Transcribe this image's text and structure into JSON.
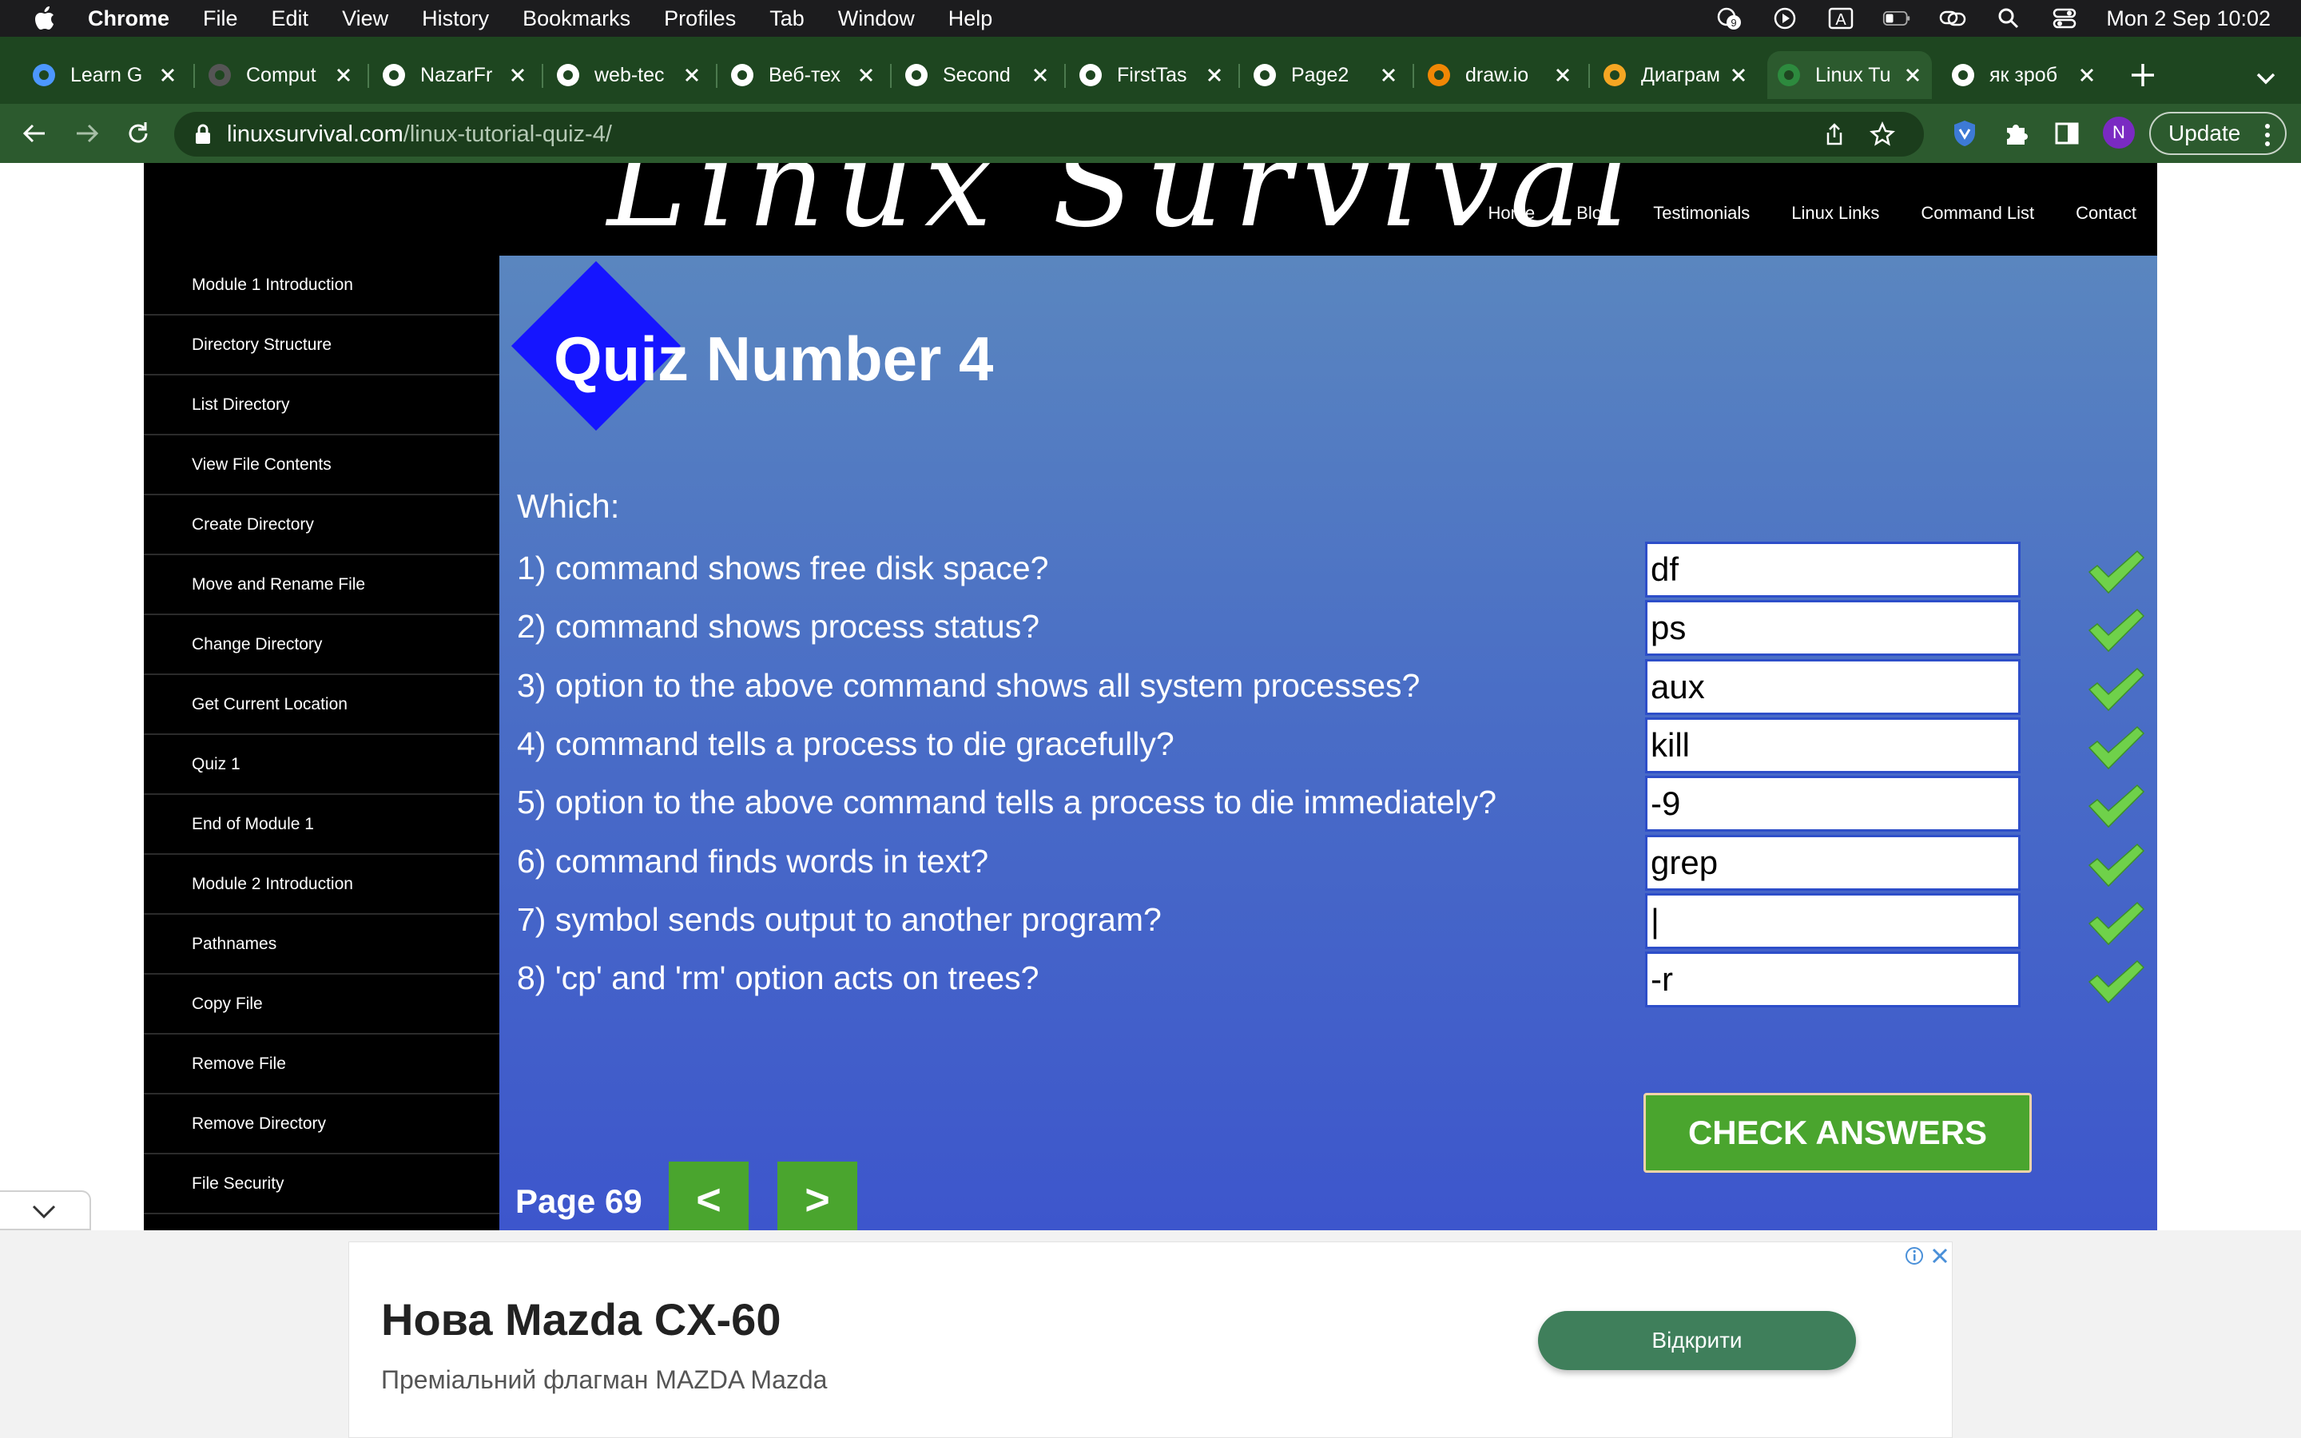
{
  "menubar": {
    "app_name": "Chrome",
    "items": [
      "File",
      "Edit",
      "View",
      "History",
      "Bookmarks",
      "Profiles",
      "Tab",
      "Window",
      "Help"
    ],
    "clock": "Mon 2 Sep  10:02",
    "input_source": "A",
    "notification_count": "9"
  },
  "tabs": [
    {
      "title": "Learn G",
      "icon": "scratch-icon",
      "color": "#4c97ff"
    },
    {
      "title": "Comput",
      "icon": "github-icon",
      "color": "#555555"
    },
    {
      "title": "NazarFr",
      "icon": "github-icon",
      "color": "#ffffff"
    },
    {
      "title": "web-tec",
      "icon": "github-icon",
      "color": "#ffffff"
    },
    {
      "title": "Веб-тех",
      "icon": "globe-icon",
      "color": "#ffffff"
    },
    {
      "title": "Second",
      "icon": "globe-icon",
      "color": "#ffffff"
    },
    {
      "title": "FirstTas",
      "icon": "globe-icon",
      "color": "#ffffff"
    },
    {
      "title": "Page2",
      "icon": "globe-icon",
      "color": "#ffffff"
    },
    {
      "title": "draw.io",
      "icon": "drawio-icon",
      "color": "#f08705"
    },
    {
      "title": "Диаграм",
      "icon": "diagram-icon",
      "color": "#f5a623"
    },
    {
      "title": "Linux Tu",
      "icon": "linux-icon",
      "color": "#2d8a3e"
    },
    {
      "title": "як зроб",
      "icon": "google-icon",
      "color": "#ffffff"
    }
  ],
  "active_tab": 10,
  "toolbar": {
    "url_host": "linuxsurvival.com",
    "url_path": "/linux-tutorial-quiz-4/",
    "profile_initial": "N",
    "update_label": "Update"
  },
  "site": {
    "nav": [
      "Home",
      "Blog",
      "Testimonials",
      "Linux Links",
      "Command List",
      "Contact"
    ],
    "sidebar": [
      "Module 1 Introduction",
      "Directory Structure",
      "List Directory",
      "View File Contents",
      "Create Directory",
      "Move and Rename File",
      "Change Directory",
      "Get Current Location",
      "Quiz 1",
      "End of Module 1",
      "Module 2 Introduction",
      "Pathnames",
      "Copy File",
      "Remove File",
      "Remove Directory",
      "File Security"
    ]
  },
  "quiz": {
    "title": "Quiz Number 4",
    "intro": "Which:",
    "questions": [
      {
        "text": "1) command shows free disk space?",
        "answer": "df",
        "correct": true
      },
      {
        "text": "2) command shows process status?",
        "answer": "ps",
        "correct": true
      },
      {
        "text": "3) option to the above command shows all system processes?",
        "answer": "aux",
        "correct": true
      },
      {
        "text": "4) command tells a process to die gracefully?",
        "answer": "kill",
        "correct": true
      },
      {
        "text": "5) option to the above command tells a process to die immediately?",
        "answer": "-9",
        "correct": true
      },
      {
        "text": "6) command finds words in text?",
        "answer": "grep",
        "correct": true
      },
      {
        "text": "7) symbol sends output to another program?",
        "answer": "|",
        "correct": true
      },
      {
        "text": "8) 'cp' and 'rm' option acts on trees?",
        "answer": "-r",
        "correct": true
      }
    ],
    "check_label": "CHECK ANSWERS",
    "page_label": "Page 69",
    "prev_label": "<",
    "next_label": ">"
  },
  "ad": {
    "title": "Нова Mazda CX-60",
    "subtitle": "Преміальний флагман MAZDA Mazda",
    "cta": "Відкрити"
  },
  "colors": {
    "tab_strip": "#1e4620",
    "toolbar": "#2c5a2e",
    "quiz_bg_top": "#5a86bf",
    "quiz_bg_bottom": "#3d56cc",
    "button_green": "#4aa52e",
    "check_green": "#6fd14a"
  }
}
